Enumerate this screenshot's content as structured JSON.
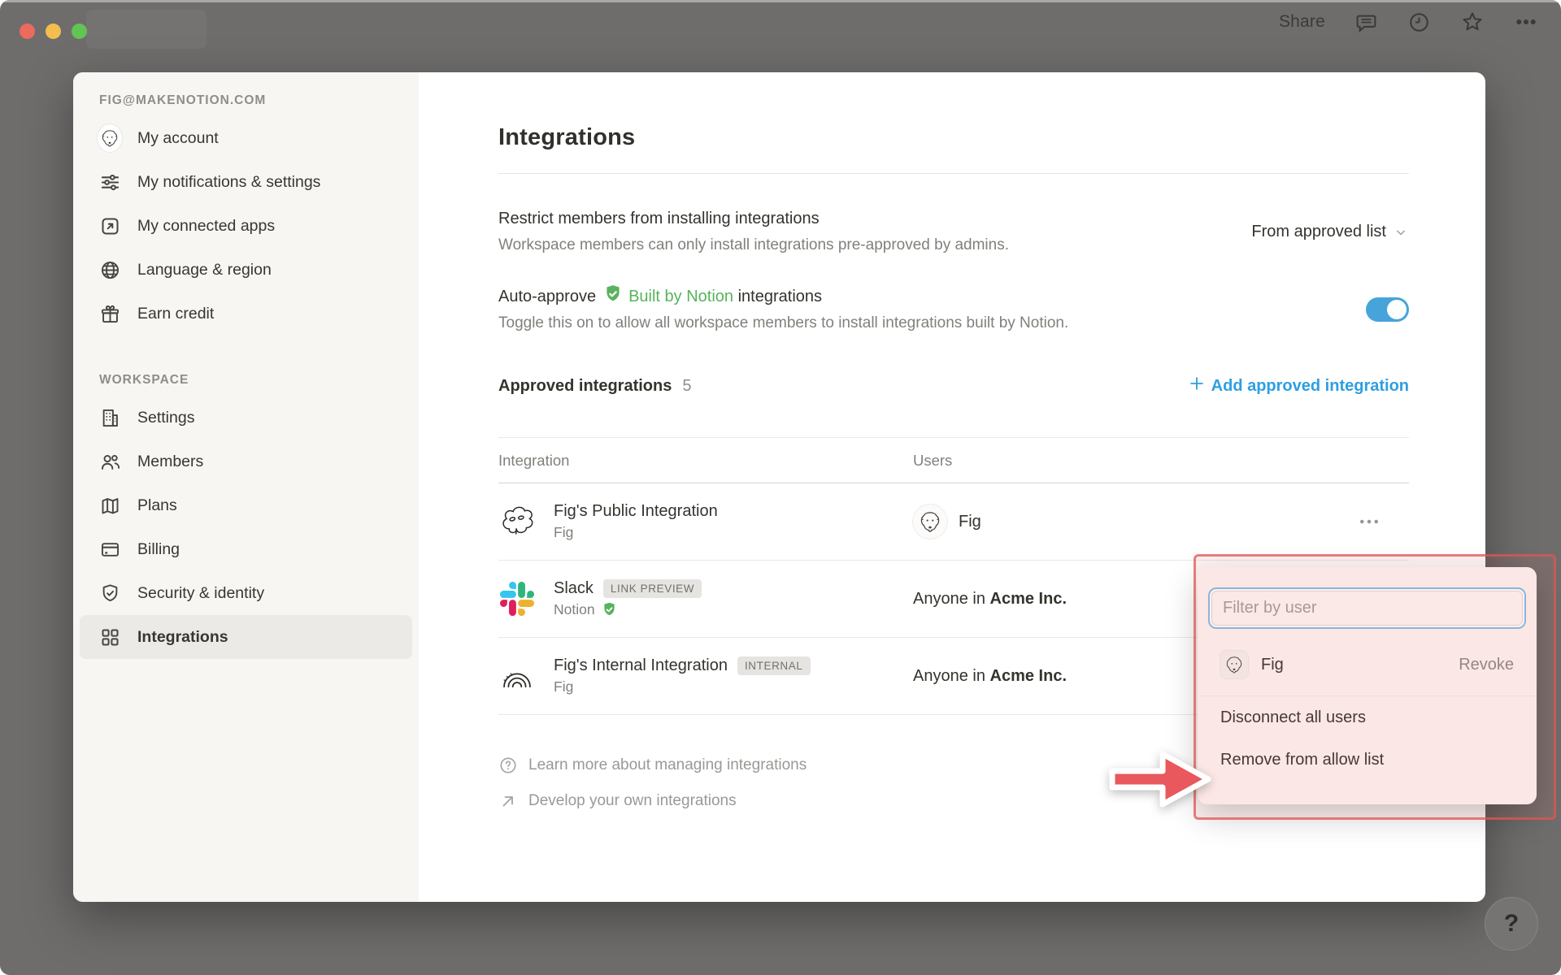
{
  "topbar": {
    "share_label": "Share",
    "icons": {
      "comment": "speech-bubble",
      "updates": "clock",
      "favorite": "star",
      "more": "ellipsis"
    }
  },
  "sidebar": {
    "account_header": "FIG@MAKENOTION.COM",
    "account_items": [
      {
        "label": "My account",
        "icon": "user-avatar"
      },
      {
        "label": "My notifications & settings",
        "icon": "sliders"
      },
      {
        "label": "My connected apps",
        "icon": "arrow-up-right-box"
      },
      {
        "label": "Language & region",
        "icon": "globe"
      },
      {
        "label": "Earn credit",
        "icon": "gift"
      }
    ],
    "workspace_header": "WORKSPACE",
    "workspace_items": [
      {
        "label": "Settings",
        "icon": "building"
      },
      {
        "label": "Members",
        "icon": "people"
      },
      {
        "label": "Plans",
        "icon": "map"
      },
      {
        "label": "Billing",
        "icon": "credit-card"
      },
      {
        "label": "Security & identity",
        "icon": "shield-check"
      },
      {
        "label": "Integrations",
        "icon": "grid",
        "selected": true
      }
    ]
  },
  "main": {
    "title": "Integrations",
    "restrict": {
      "title": "Restrict members from installing integrations",
      "desc": "Workspace members can only install integrations pre-approved by admins.",
      "dropdown_value": "From approved list"
    },
    "auto_approve": {
      "prefix": "Auto-approve",
      "highlight": "Built by Notion",
      "suffix": "integrations",
      "desc": "Toggle this on to allow all workspace members to install integrations built by Notion.",
      "toggle_state": "on"
    },
    "approved_header": {
      "title": "Approved integrations",
      "count": "5",
      "add_label": "Add approved integration"
    },
    "table": {
      "col_integration": "Integration",
      "col_users": "Users",
      "rows": [
        {
          "name": "Fig's Public Integration",
          "badge": "",
          "owner": "Fig",
          "owner_verified": false,
          "user_name": "Fig",
          "icon": "scribble-doodle"
        },
        {
          "name": "Slack",
          "badge": "LINK PREVIEW",
          "owner": "Notion",
          "owner_verified": true,
          "users_prefix": "Anyone in",
          "users_org": "Acme Inc.",
          "icon": "slack-logo"
        },
        {
          "name": "Fig's Internal Integration",
          "badge": "INTERNAL",
          "owner": "Fig",
          "owner_verified": false,
          "users_prefix": "Anyone in",
          "users_org": "Acme Inc.",
          "icon": "arcs-doodle"
        }
      ]
    },
    "footer_links": [
      {
        "label": "Learn more about managing integrations",
        "icon": "question-circle"
      },
      {
        "label": "Develop your own integrations",
        "icon": "arrow-up-right"
      }
    ]
  },
  "popup": {
    "filter_placeholder": "Filter by user",
    "user_row": {
      "name": "Fig",
      "action_label": "Revoke"
    },
    "menu_items": [
      {
        "label": "Disconnect all users"
      },
      {
        "label": "Remove from allow list"
      }
    ]
  },
  "help_label": "?",
  "colors": {
    "backdrop": "#6e6d6c",
    "sidebar_bg": "#f7f6f3",
    "selected_item_bg": "#ebeae7",
    "text_primary": "#34332e",
    "text_secondary": "#82807b",
    "accent_blue": "#2e9fe1",
    "toggle_blue": "#46a4da",
    "notion_green": "#58b35c",
    "annotation_red": "#df5652",
    "slack_colors": [
      "#36C5F0",
      "#2EB67D",
      "#ECB22E",
      "#E01E5A"
    ]
  }
}
